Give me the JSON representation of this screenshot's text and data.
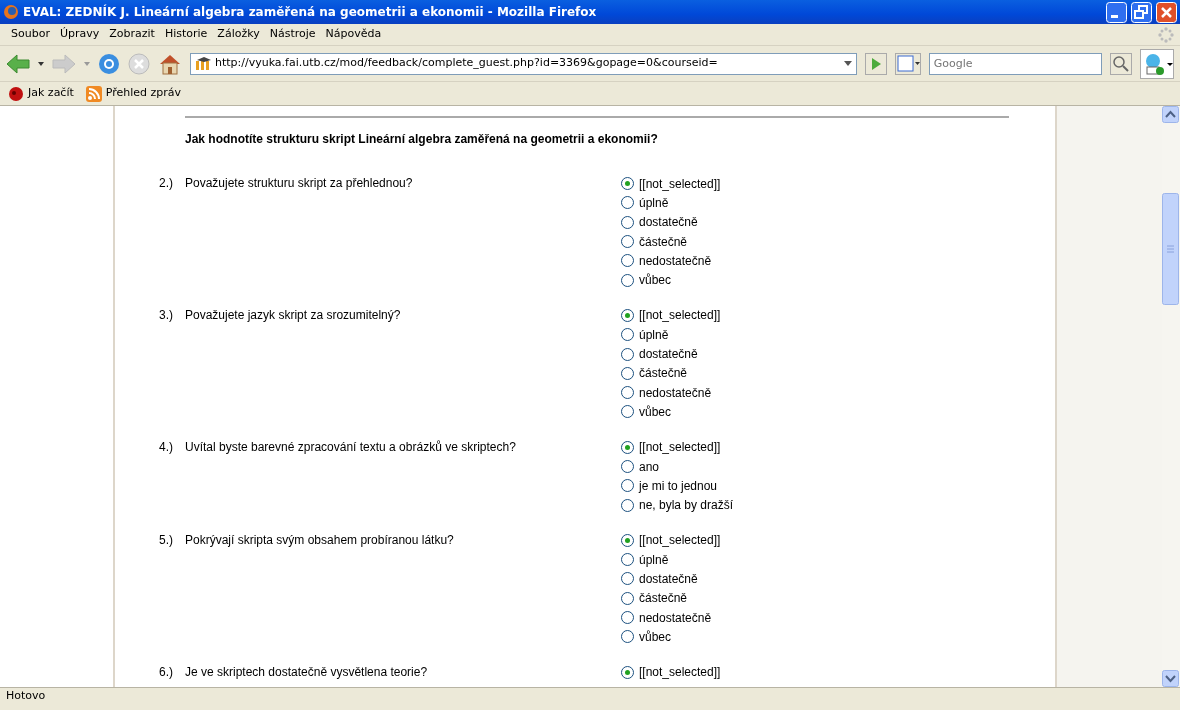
{
  "window": {
    "title": "EVAL: ZEDNÍK J. Lineární algebra zaměřená na geometrii a ekonomii - Mozilla Firefox"
  },
  "menu": [
    "Soubor",
    "Úpravy",
    "Zobrazit",
    "Historie",
    "Záložky",
    "Nástroje",
    "Nápověda"
  ],
  "address_bar": {
    "value": "http://vyuka.fai.utb.cz/mod/feedback/complete_guest.php?id=3369&gopage=0&courseid="
  },
  "search_bar": {
    "placeholder": "Google"
  },
  "bookmarks": [
    "Jak začít",
    "Přehled zpráv"
  ],
  "heading": "Jak hodnotíte strukturu skript Lineární algebra zaměřená na geometrii a ekonomii?",
  "questions": [
    {
      "number": "2.)",
      "text": "Považujete strukturu skript za přehlednou?",
      "options": [
        {
          "label": "[[not_selected]]",
          "selected": true
        },
        {
          "label": "úplně",
          "selected": false
        },
        {
          "label": "dostatečně",
          "selected": false
        },
        {
          "label": "částečně",
          "selected": false
        },
        {
          "label": "nedostatečně",
          "selected": false
        },
        {
          "label": "vůbec",
          "selected": false
        }
      ]
    },
    {
      "number": "3.)",
      "text": "Považujete jazyk skript za srozumitelný?",
      "options": [
        {
          "label": "[[not_selected]]",
          "selected": true
        },
        {
          "label": "úplně",
          "selected": false
        },
        {
          "label": "dostatečně",
          "selected": false
        },
        {
          "label": "částečně",
          "selected": false
        },
        {
          "label": "nedostatečně",
          "selected": false
        },
        {
          "label": "vůbec",
          "selected": false
        }
      ]
    },
    {
      "number": "4.)",
      "text": "Uvítal byste barevné zpracování textu a obrázků ve skriptech?",
      "options": [
        {
          "label": "[[not_selected]]",
          "selected": true
        },
        {
          "label": "ano",
          "selected": false
        },
        {
          "label": "je mi to jednou",
          "selected": false
        },
        {
          "label": "ne, byla by dražší",
          "selected": false
        }
      ]
    },
    {
      "number": "5.)",
      "text": "Pokrývají skripta svým obsahem probíranou látku?",
      "options": [
        {
          "label": "[[not_selected]]",
          "selected": true
        },
        {
          "label": "úplně",
          "selected": false
        },
        {
          "label": "dostatečně",
          "selected": false
        },
        {
          "label": "částečně",
          "selected": false
        },
        {
          "label": "nedostatečně",
          "selected": false
        },
        {
          "label": "vůbec",
          "selected": false
        }
      ]
    },
    {
      "number": "6.)",
      "text": "Je ve skriptech dostatečně vysvětlena teorie?",
      "options": [
        {
          "label": "[[not_selected]]",
          "selected": true
        }
      ]
    }
  ],
  "status_bar": "Hotovo"
}
